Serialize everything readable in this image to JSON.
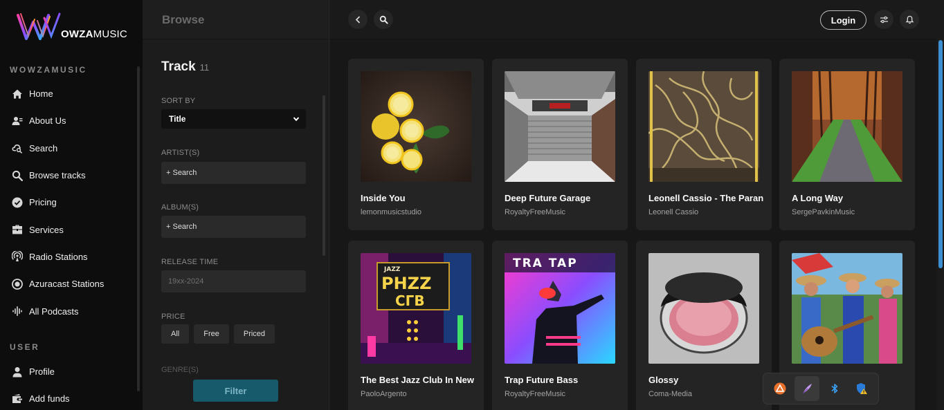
{
  "brand": {
    "logo_strong": "OWZA",
    "logo_light": "MUSIC"
  },
  "sidebar": {
    "section_main": "WOWZAMUSIC",
    "items": [
      {
        "label": "Home",
        "icon": "home-icon"
      },
      {
        "label": "About Us",
        "icon": "user-info-icon"
      },
      {
        "label": "Search",
        "icon": "search-cloud-icon"
      },
      {
        "label": "Browse tracks",
        "icon": "search-icon"
      },
      {
        "label": "Pricing",
        "icon": "check-circle-icon"
      },
      {
        "label": "Services",
        "icon": "briefcase-icon"
      },
      {
        "label": "Radio Stations",
        "icon": "radio-icon"
      },
      {
        "label": "Azuracast Stations",
        "icon": "target-icon"
      },
      {
        "label": "All Podcasts",
        "icon": "podcast-icon"
      }
    ],
    "section_user": "USER",
    "user_items": [
      {
        "label": "Profile",
        "icon": "person-icon"
      },
      {
        "label": "Add funds",
        "icon": "wallet-icon"
      }
    ]
  },
  "filters": {
    "browse_title": "Browse",
    "title": "Track",
    "count": "11",
    "sort_label": "SORT BY",
    "sort_value": "Title",
    "artist_label": "ARTIST(S)",
    "artist_placeholder": "+ Search",
    "album_label": "ALBUM(S)",
    "album_placeholder": "+ Search",
    "release_label": "RELEASE TIME",
    "release_placeholder": "19xx-2024",
    "price_label": "PRICE",
    "price_options": [
      "All",
      "Free",
      "Priced"
    ],
    "genre_label": "GENRE(S)",
    "filter_button": "Filter"
  },
  "topbar": {
    "login": "Login"
  },
  "tracks": [
    {
      "title": "Inside You",
      "artist": "lemonmusicstudio"
    },
    {
      "title": "Deep Future Garage",
      "artist": "RoyaltyFreeMusic"
    },
    {
      "title": "Leonell Cassio - The Paran",
      "artist": "Leonell Cassio"
    },
    {
      "title": "A Long Way",
      "artist": "SergePavkinMusic"
    },
    {
      "title": "The Best Jazz Club In New",
      "artist": "PaoloArgento"
    },
    {
      "title": "Trap Future Bass",
      "artist": "RoyaltyFreeMusic"
    },
    {
      "title": "Glossy",
      "artist": "Coma-Media"
    },
    {
      "title": "",
      "artist": ""
    }
  ],
  "artwork_text": {
    "jazz_sign_top": "JAZZ",
    "jazz_sign_a": "PHZZ",
    "jazz_sign_b": "СГВ",
    "trap_title": "TRA TAP"
  },
  "colors": {
    "accent": "#175a6b",
    "scroll_thumb": "#3d8fd1",
    "sidebar_bg": "#0d0d0d",
    "card_bg": "#242424"
  }
}
